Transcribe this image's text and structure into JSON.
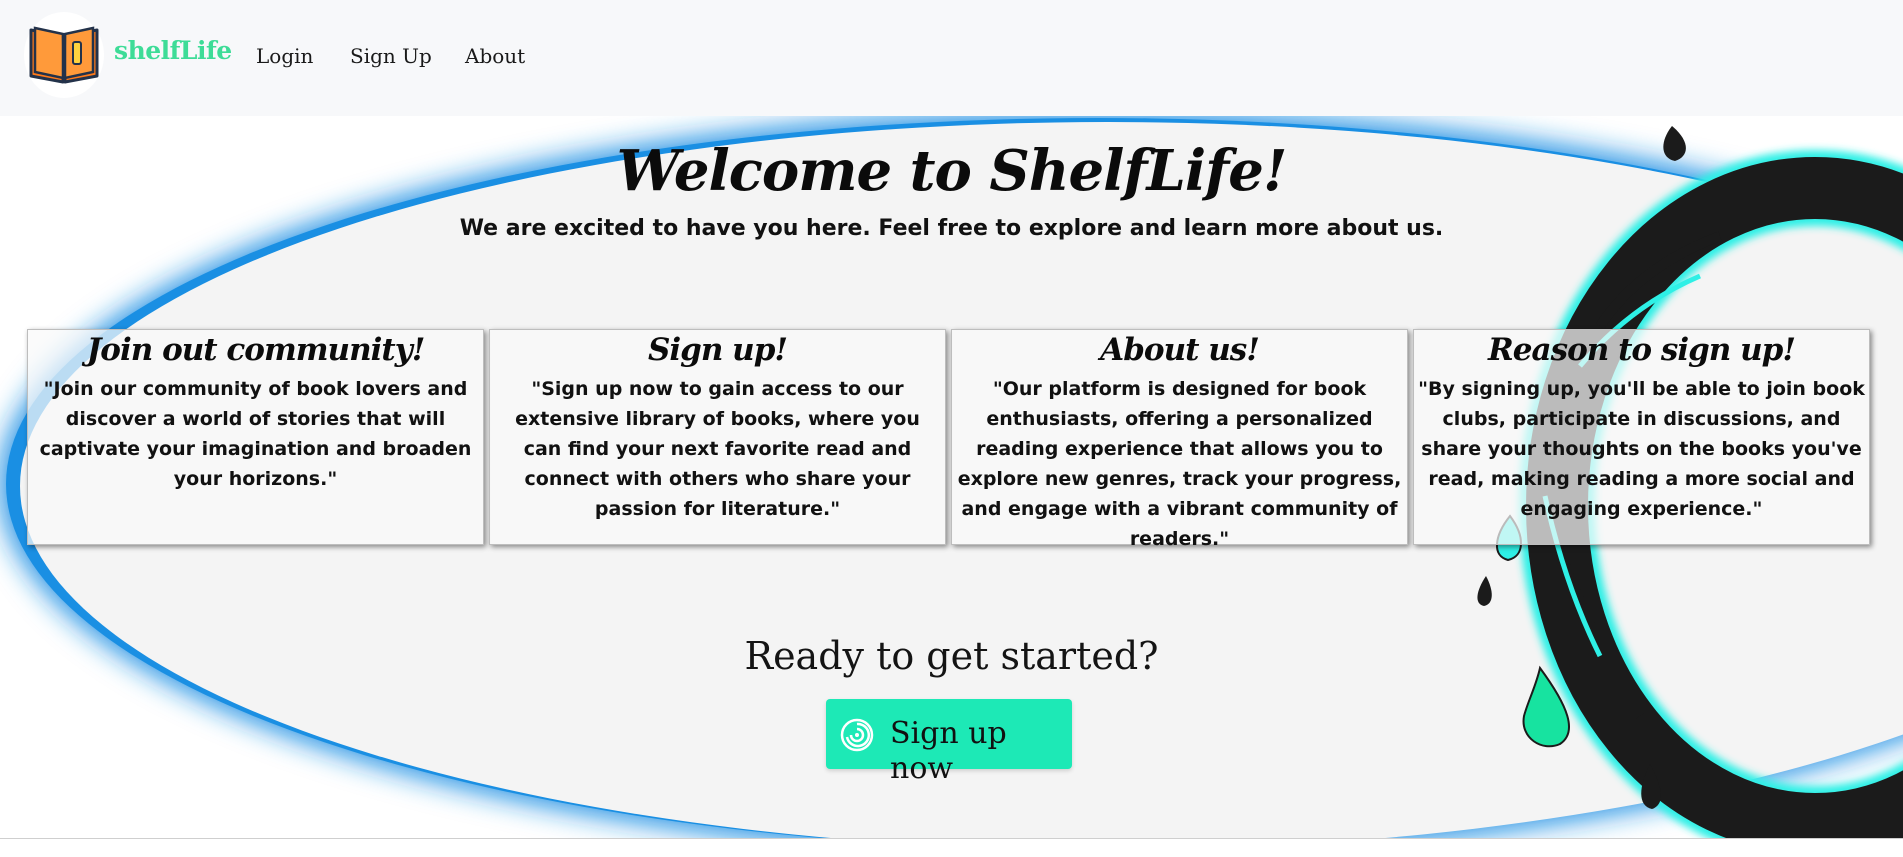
{
  "navbar": {
    "brand": "shelfLife",
    "logo_icon": "open-book-icon",
    "links": [
      "Login",
      "Sign Up",
      "About"
    ]
  },
  "hero": {
    "title": "Welcome to ShelfLife!",
    "subtitle": "We are excited to have you here. Feel free to explore and learn more about us."
  },
  "cards": [
    {
      "title": "Join out community!",
      "text": "\"Join our community of book lovers and discover a world of stories that will captivate your imagination and broaden your horizons.\""
    },
    {
      "title": "Sign up!",
      "text": "\"Sign up now to gain access to our extensive library of books, where you can find your next favorite read and connect with others who share your passion for literature.\""
    },
    {
      "title": "About us!",
      "text": "\"Our platform is designed for book enthusiasts, offering a personalized reading experience that allows you to explore new genres, track your progress, and engage with a vibrant community of readers.\""
    },
    {
      "title": "Reason to sign up!",
      "text": "\"By signing up, you'll be able to join book clubs, participate in discussions, and share your thoughts on the books you've read, making reading a more social and engaging experience.\""
    }
  ],
  "cta": {
    "heading": "Ready to get started?",
    "button_label": "Sign up now",
    "button_icon": "spiral-icon"
  },
  "colors": {
    "brand_green": "#3ddc97",
    "cta_teal": "#1de9b6",
    "ellipse_blue": "#1a8fe3",
    "splash_cyan": "#2ef0e6",
    "splash_dark": "#1a1a1a"
  }
}
